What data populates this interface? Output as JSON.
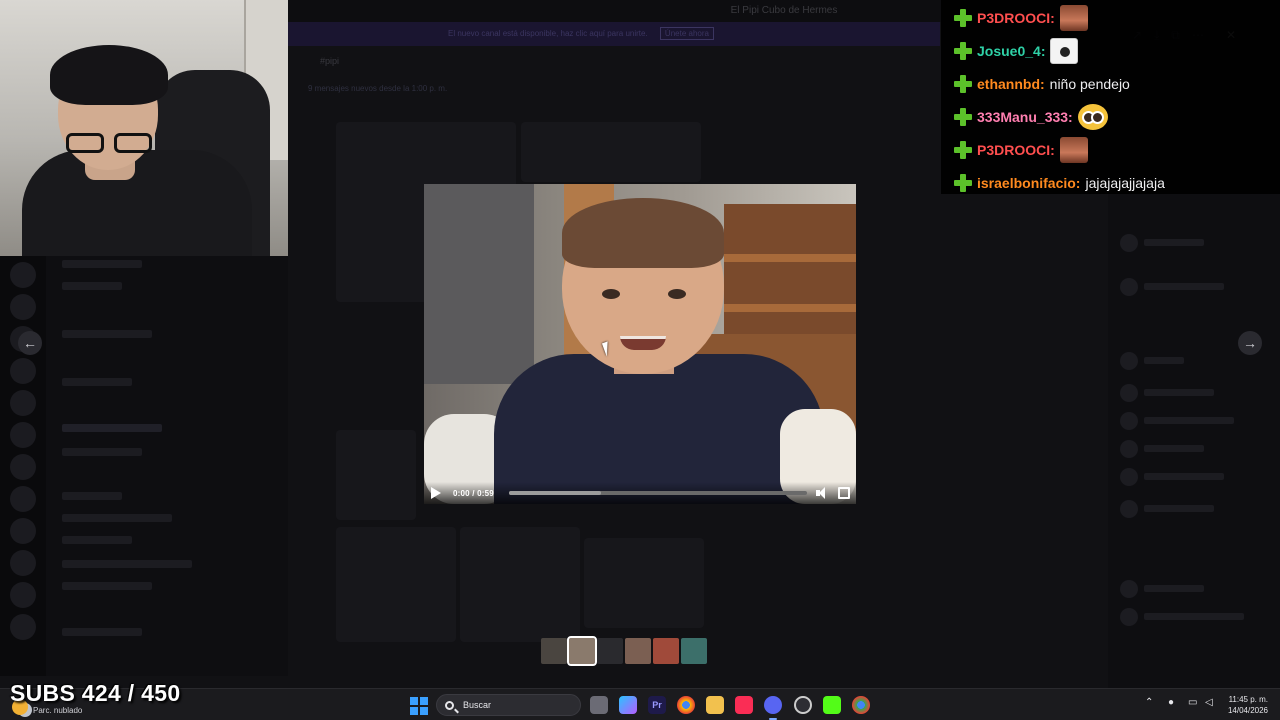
{
  "window": {
    "title": "El Pipi Cubo de Hermes",
    "banner_text": "El nuevo canal está disponible, haz clic aquí para unirte.",
    "banner_button": "Únete ahora",
    "channel_header": "#pipi",
    "unread_text": "9 mensajes nuevos desde la 1:00 p. m."
  },
  "chat": {
    "messages": [
      {
        "user": "P3DROOCI:",
        "color": "#ff4f4f",
        "text": "",
        "emote": "face"
      },
      {
        "user": "Josue0_4:",
        "color": "#2fd1a7",
        "text": "",
        "emote": "ghost"
      },
      {
        "user": "ethannbd:",
        "color": "#ff8a1f",
        "text": "niño pendejo",
        "emote": ""
      },
      {
        "user": "333Manu_333:",
        "color": "#ff7fb0",
        "text": "",
        "emote": "pleading"
      },
      {
        "user": "P3DROOCI:",
        "color": "#ff4f4f",
        "text": "",
        "emote": "face"
      },
      {
        "user": "israelbonifacio:",
        "color": "#ff8a1f",
        "text": "jajajajajjajaja",
        "emote": ""
      }
    ]
  },
  "player": {
    "time": "0:00 / 0:59",
    "progress": 0.0,
    "buffered": 0.31
  },
  "nav": {
    "prev": "←",
    "next": "→"
  },
  "overlay": {
    "subs": "SUBS 424 / 450"
  },
  "taskbar": {
    "weather": "Parc. nublado",
    "search_placeholder": "Buscar",
    "time": "11:45 p. m.",
    "date": "14/04/2026",
    "accent": "#3aa0ff"
  }
}
